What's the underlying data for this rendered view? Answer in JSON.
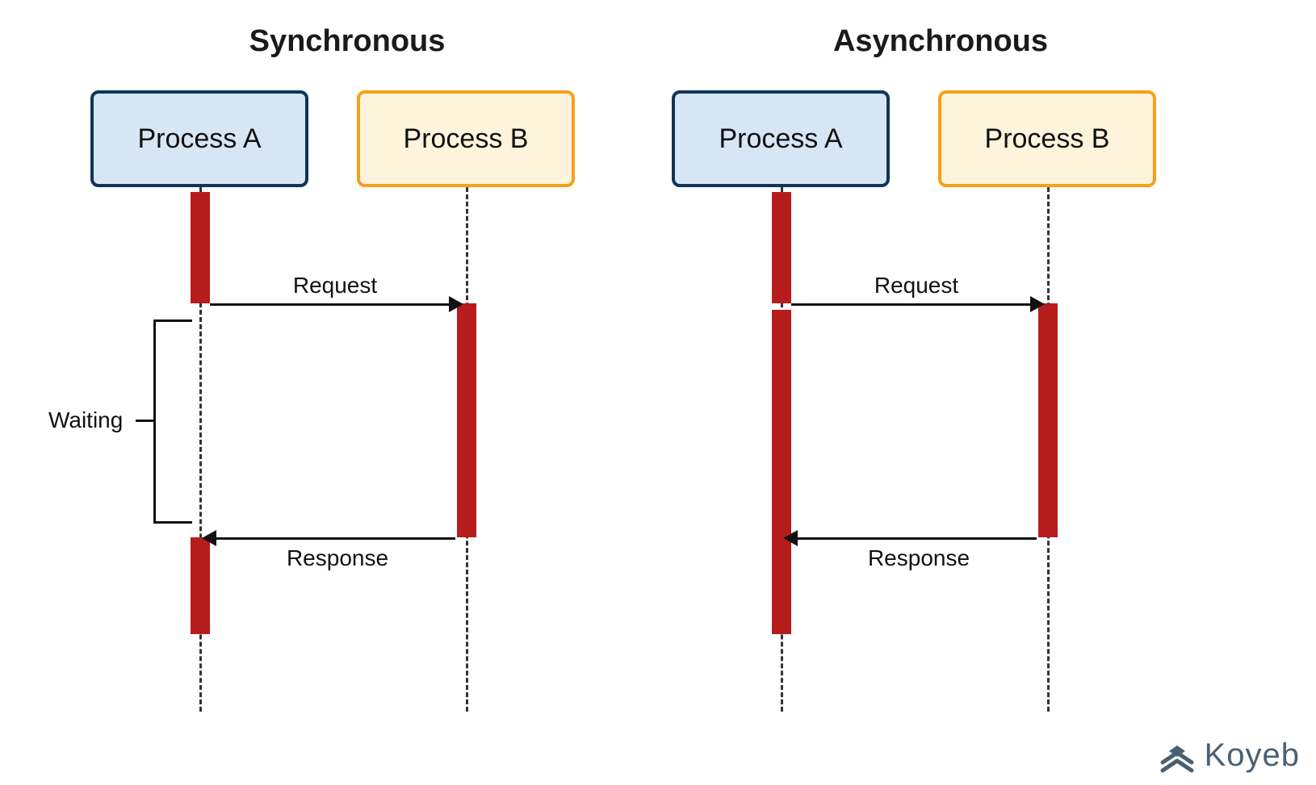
{
  "titles": {
    "sync": "Synchronous",
    "async": "Asynchronous"
  },
  "processes": {
    "a": "Process A",
    "b": "Process B"
  },
  "messages": {
    "request": "Request",
    "response": "Response"
  },
  "labels": {
    "waiting": "Waiting"
  },
  "attribution": "Koyeb",
  "colors": {
    "proc_a_fill": "#D7E6F5",
    "proc_a_border": "#0F355B",
    "proc_b_fill": "#FEF3DB",
    "proc_b_border": "#F6A01A",
    "exec_bar": "#B71C1C",
    "line": "#111111",
    "attribution": "#4A6072"
  }
}
